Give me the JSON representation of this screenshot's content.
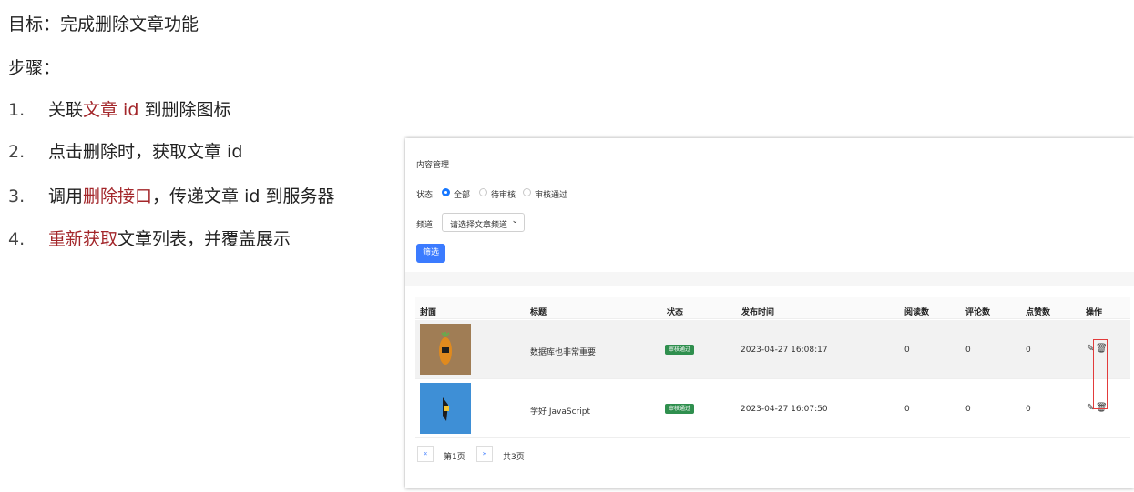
{
  "slide": {
    "goal": "目标：完成删除文章功能",
    "steps_label": "步骤：",
    "steps": [
      {
        "num": "1.",
        "parts": [
          {
            "text": "关联",
            "red": false
          },
          {
            "text": "文章 id",
            "red": true
          },
          {
            "text": " 到删除图标",
            "red": false
          }
        ]
      },
      {
        "num": "2.",
        "parts": [
          {
            "text": "点击删除时，获取文章 id",
            "red": false
          }
        ]
      },
      {
        "num": "3.",
        "parts": [
          {
            "text": "调用",
            "red": false
          },
          {
            "text": "删除接口",
            "red": true
          },
          {
            "text": "，传递文章 id 到服务器",
            "red": false
          }
        ]
      },
      {
        "num": "4.",
        "parts": [
          {
            "text": "重新获取",
            "red": true
          },
          {
            "text": "文章列表，并覆盖展示",
            "red": false
          }
        ]
      }
    ]
  },
  "app": {
    "title": "内容管理",
    "status_label": "状态:",
    "status_options": [
      "全部",
      "待审核",
      "审核通过"
    ],
    "status_selected": "全部",
    "channel_label": "频道:",
    "channel_placeholder": "请选择文章频道",
    "filter_button": "筛选",
    "table": {
      "columns": [
        "封面",
        "标题",
        "状态",
        "发布时间",
        "阅读数",
        "评论数",
        "点赞数",
        "操作"
      ],
      "rows": [
        {
          "title": "数据库也非常重要",
          "status": "审核通过",
          "time": "2023-04-27 16:08:17",
          "reads": "0",
          "comments": "0",
          "likes": "0",
          "cover": "carrot-figure-image"
        },
        {
          "title": "学好 JavaScript",
          "status": "审核通过",
          "time": "2023-04-27 16:07:50",
          "reads": "0",
          "comments": "0",
          "likes": "0",
          "cover": "figure-blue-background-image"
        }
      ]
    },
    "pager": {
      "prev": "«",
      "current": "第1页",
      "next": "»",
      "total": "共3页"
    }
  },
  "colors": {
    "accent_red": "#a3262a",
    "primary_blue": "#3b7bff",
    "tag_green": "#2f8f4e",
    "highlight_box": "#e23b3b"
  }
}
